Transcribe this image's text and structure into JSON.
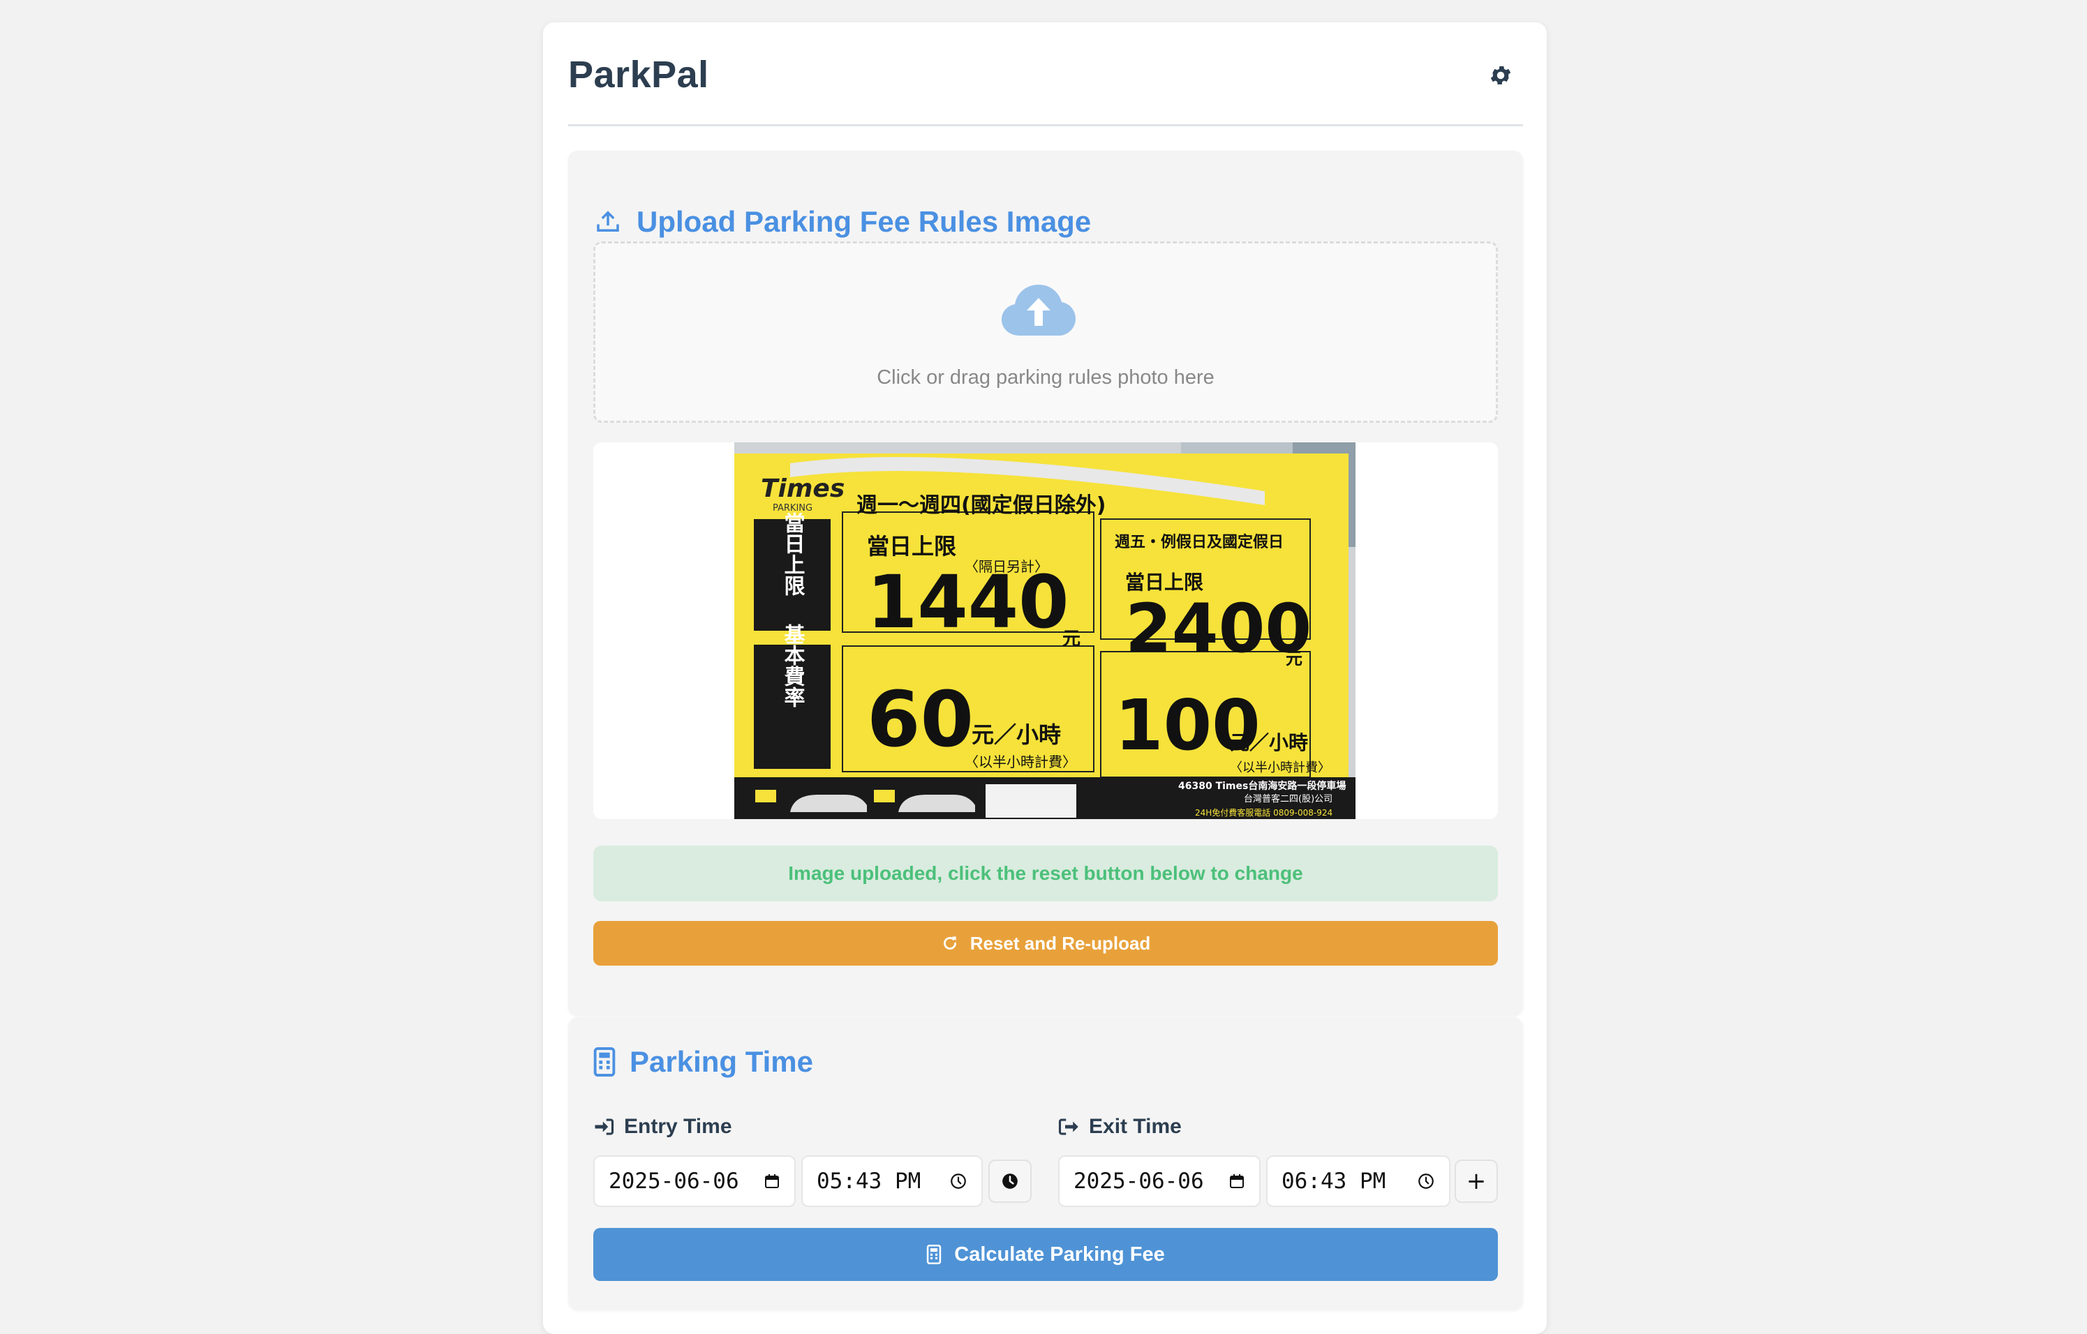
{
  "app": {
    "title": "ParkPal"
  },
  "upload": {
    "title": "Upload Parking Fee Rules Image",
    "drop_hint": "Click or drag parking rules photo here",
    "status": "Image uploaded, click the reset button below to change",
    "reset_label": "Reset and Re-upload",
    "sign": {
      "brand": "Times",
      "brand_sub": "PARKING",
      "weekday_header": "週一～週四(國定假日除外)",
      "weekend_header": "週五・例假日及國定假日",
      "daily_cap_label": "當日上限",
      "next_day_note": "〈隔日另計〉",
      "weekday_cap": "1440",
      "weekend_cap": "2400",
      "currency": "元",
      "base_rate_label": "基本費率",
      "weekday_rate": "60",
      "weekend_rate": "100",
      "per_hour": "元／小時",
      "half_hour_note": "〈以半小時計費〉",
      "side_cap": "當日上限",
      "side_rate": "基本費率",
      "lot_info": "46380 Times台南海安路一段停車場",
      "company": "台灣普客二四(股)公司",
      "hotline": "24H免付費客服電話 0809-008-924"
    }
  },
  "parking_time": {
    "title": "Parking Time",
    "entry_label": "Entry Time",
    "exit_label": "Exit Time",
    "entry_date": "2025-06-06",
    "entry_time": "05:43 PM",
    "exit_date": "2025-06-06",
    "exit_time": "06:43 PM",
    "add_label": "+",
    "calculate_label": "Calculate Parking Fee"
  },
  "colors": {
    "accent": "#4a90e2",
    "reset": "#e8a13a",
    "success_bg": "#d9ecdf",
    "success_text": "#4cc07a",
    "sign_yellow": "#f6e23a"
  },
  "icons": [
    "gear-icon",
    "upload-icon",
    "cloud-upload-icon",
    "refresh-icon",
    "calculator-icon",
    "sign-in-icon",
    "sign-out-icon",
    "calendar-icon",
    "clock-icon"
  ]
}
